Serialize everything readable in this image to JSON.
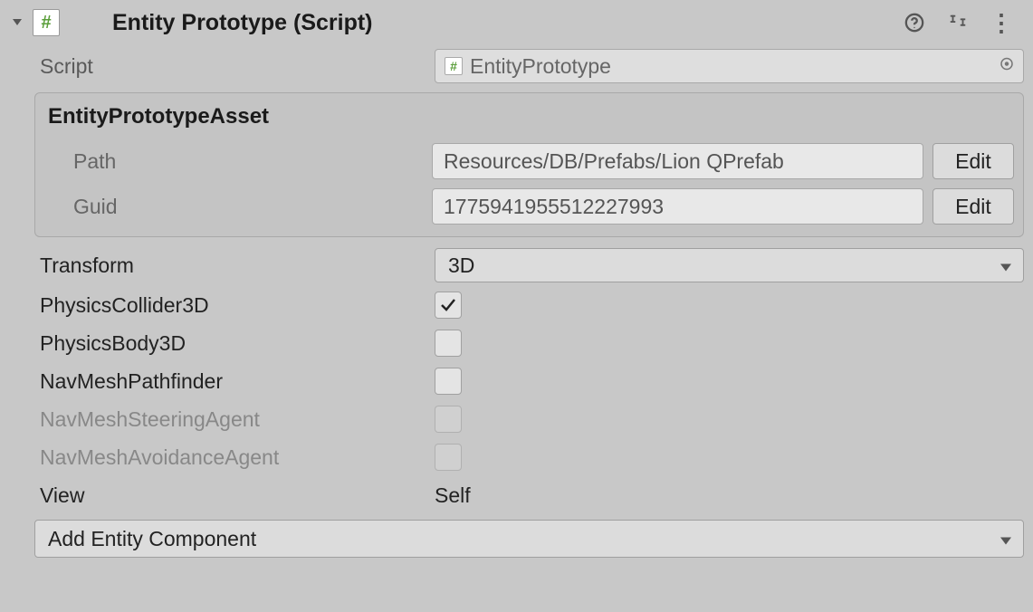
{
  "header": {
    "title": "Entity Prototype (Script)"
  },
  "script": {
    "label": "Script",
    "value": "EntityPrototype"
  },
  "asset": {
    "title": "EntityPrototypeAsset",
    "path_label": "Path",
    "path_value": "Resources/DB/Prefabs/Lion QPrefab",
    "guid_label": "Guid",
    "guid_value": "1775941955512227993",
    "edit_label": "Edit"
  },
  "transform": {
    "label": "Transform",
    "value": "3D"
  },
  "physicsCollider3D": {
    "label": "PhysicsCollider3D",
    "checked": true
  },
  "physicsBody3D": {
    "label": "PhysicsBody3D",
    "checked": false
  },
  "navMeshPathfinder": {
    "label": "NavMeshPathfinder",
    "checked": false
  },
  "navMeshSteeringAgent": {
    "label": "NavMeshSteeringAgent",
    "checked": false
  },
  "navMeshAvoidanceAgent": {
    "label": "NavMeshAvoidanceAgent",
    "checked": false
  },
  "view": {
    "label": "View",
    "value": "Self"
  },
  "addComponent": {
    "label": "Add Entity Component"
  }
}
